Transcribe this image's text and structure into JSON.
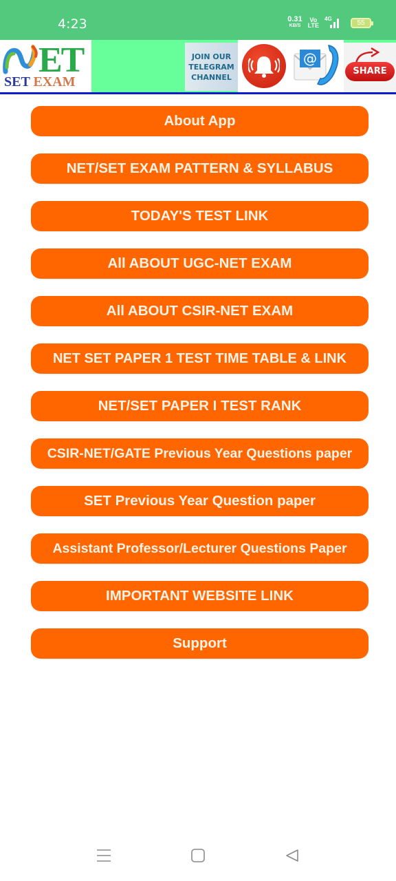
{
  "status_bar": {
    "time": "4:23",
    "net_speed_value": "0.31",
    "net_speed_unit": "KB/S",
    "volte_top": "Vo",
    "volte_bottom": "LTE",
    "network_type": "4G",
    "battery_level": "55"
  },
  "header": {
    "logo_main": "ET",
    "logo_sub_set": "SET",
    "logo_sub_exam": "EXAM",
    "telegram_line1": "JOIN OUR",
    "telegram_line2": "TELEGRAM",
    "telegram_line3": "CHANNEL",
    "share_label": "SHARE",
    "icons": {
      "logo": "net-swirl-logo-icon",
      "notification": "bell-icon",
      "contact": "email-phone-icon",
      "share": "share-arrow-icon"
    },
    "colors": {
      "header_bg": "#66ff99",
      "status_bg": "#52c97c",
      "divider": "#0a1ccc"
    }
  },
  "menu": {
    "button_color": "#ff6600",
    "items": [
      {
        "label": "About App"
      },
      {
        "label": "NET/SET EXAM PATTERN & SYLLABUS"
      },
      {
        "label": "TODAY'S TEST LINK"
      },
      {
        "label": "All ABOUT UGC-NET EXAM"
      },
      {
        "label": "All ABOUT CSIR-NET EXAM"
      },
      {
        "label": "NET SET PAPER 1 TEST TIME TABLE & LINK"
      },
      {
        "label": "NET/SET PAPER I TEST RANK"
      },
      {
        "label": "CSIR-NET/GATE Previous Year Questions paper"
      },
      {
        "label": "SET Previous Year Question paper"
      },
      {
        "label": "Assistant Professor/Lecturer Questions Paper"
      },
      {
        "label": "IMPORTANT WEBSITE LINK"
      },
      {
        "label": "Support"
      }
    ]
  },
  "nav_bar": {
    "recents": "menu-icon",
    "home": "home-square-icon",
    "back": "back-triangle-icon"
  }
}
